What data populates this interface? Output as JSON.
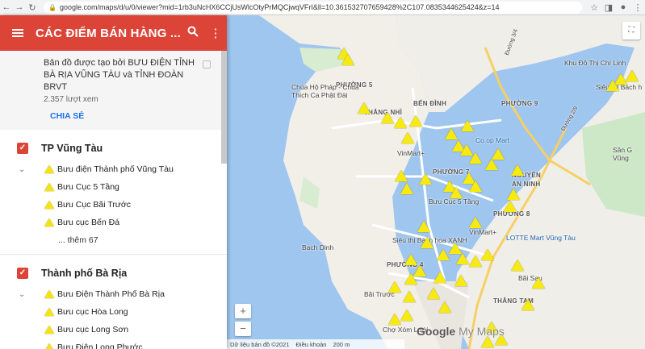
{
  "browser": {
    "url": "google.com/maps/d/u/0/viewer?mid=1rb3uNcHX6CCjUsWlcOtyPrMQCjwqVFrI&ll=10.361532707659428%2C107.0835344625424&z=14",
    "back": "←",
    "forward": "→",
    "reload": "↻"
  },
  "panel": {
    "title": "CÁC ĐIỂM BÁN HÀNG ...",
    "creator": "Bản đồ được tạo bởi BƯU ĐIỆN TỈNH BÀ RỊA VŨNG TÀU và TỈNH ĐOÀN BRVT",
    "views": "2.357 lượt xem",
    "share": "CHIA SẺ",
    "layers": [
      {
        "name": "TP Vũng Tàu",
        "items": [
          "Bưu điện Thành phố Vũng Tàu",
          "Bưu Cục 5 Tầng",
          "Bưu Cục Bãi Trước",
          "Bưu cục Bến Đá"
        ],
        "more": "... thêm 67"
      },
      {
        "name": "Thành phố Bà Rịa",
        "items": [
          "Bưu Điện Thành Phố Bà Rịa",
          "Bưu cục Hòa Long",
          "Bưu cục Long Sơn",
          "Bưu Điện Long Phước"
        ]
      }
    ]
  },
  "map": {
    "labels": {
      "phuong5": "PHƯỜNG 5",
      "chua": "Chùa Hộ Pháp - Chùa\nThích Ca Phật Đài",
      "bendinh": "BẾN ĐÌNH",
      "phuong9": "PHƯỜNG 9",
      "thangnhi": "THẮNG NHÌ",
      "coop": "Co.op Mart",
      "vinmart1": "VinMart+",
      "phuong7": "PHƯỜNG 7",
      "nguyenanninh": "NGUYỄN\nAN NINH",
      "bc5tang": "Bưu Cục 5 Tầng",
      "phuong8": "PHƯỜNG 8",
      "vinmart2": "VinMart+",
      "lotte": "LOTTE Mart Vũng Tàu",
      "bachdinh": "Bạch Dinh",
      "sieuthi": "Siêu thị Bách hoa XANH",
      "phuong4": "PHƯỜNG 4",
      "baitruoc": "Bãi Trước",
      "baisau": "Bãi Sau",
      "thangtam": "THẮNG TAM",
      "khudothi": "Khu Đô Thị Chí Linh",
      "sieuthi2": "Siêu thị Bách h",
      "sangolf": "Sân G\nVũng",
      "chomuoi": "Chợ Xóm Lưới",
      "duong30": "Đường 3/4",
      "duong2": "Đường 2/9"
    },
    "zoom_in": "+",
    "zoom_out": "−",
    "logo_google": "Google",
    "logo_mymaps": "My Maps",
    "attribution": "Dữ liệu bản đồ ©2021",
    "terms": "Điều khoản",
    "scale": "200 m"
  }
}
